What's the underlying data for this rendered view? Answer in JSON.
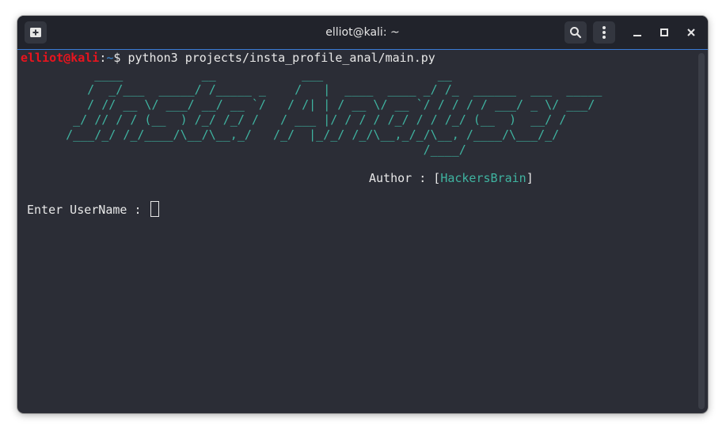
{
  "window": {
    "title": "elliot@kali: ~"
  },
  "toolbar": {
    "new_tab_icon": "new-tab-icon",
    "search_icon": "search-icon",
    "menu_icon": "kebab-menu-icon",
    "minimize_icon": "minimize-icon",
    "maximize_icon": "maximize-icon",
    "close_icon": "close-icon"
  },
  "terminal": {
    "prompt_user": "elliot@kali",
    "prompt_sep": ":",
    "prompt_path": "~",
    "prompt_symbol": "$ ",
    "command": "python3 projects/insta_profile_anal/main.py",
    "banner_art": "       ____           __            ___                __\n      /  _/___  _____/ /_____ _    /   |  ____  ____ _/ /_  ______  ___  _____\n      / // __ \\/ ___/ __/ __ `/   / /| | / __ \\/ __ `/ / / / / ___/ _ \\/ ___/\n    _/ // / / (__  ) /_/ /_/ /   / ___ |/ / / / /_/ / / /_/ (__  )  __/ /\n   /___/_/ /_/____/\\__/\\__,_/   /_/  |_/_/ /_/\\__,_/_/\\__, /____/\\___/_/\n                                                     /____/",
    "author_label": "Author : [",
    "author_name": "HackersBrain",
    "author_close": "]",
    "input_prompt": "Enter UserName : "
  },
  "colors": {
    "user": "#e8141e",
    "path": "#3c8bd6",
    "banner": "#3fb3a0",
    "background": "#2b2d36",
    "titlebar": "#21232b"
  }
}
